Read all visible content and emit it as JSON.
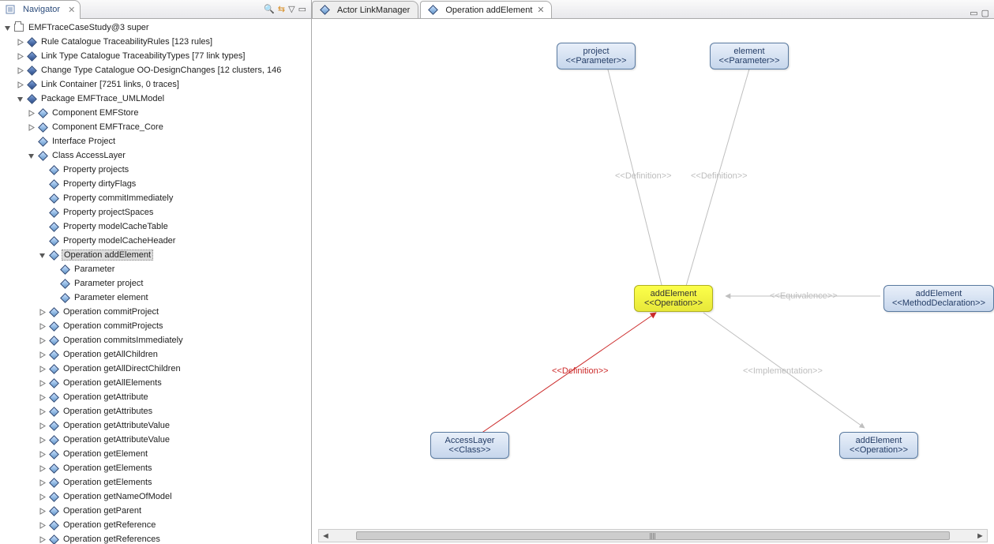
{
  "navigator": {
    "title": "Navigator",
    "root": "EMFTraceCaseStudy@3 super",
    "items": [
      {
        "ind": 1,
        "tw": "closed",
        "icon": "diamond",
        "label": "Rule Catalogue TraceabilityRules [123 rules]"
      },
      {
        "ind": 1,
        "tw": "closed",
        "icon": "diamond",
        "label": "Link Type Catalogue TraceabilityTypes [77 link types]"
      },
      {
        "ind": 1,
        "tw": "closed",
        "icon": "diamond",
        "label": "Change Type Catalogue OO-DesignChanges [12 clusters, 146"
      },
      {
        "ind": 1,
        "tw": "closed",
        "icon": "diamond",
        "label": "Link Container [7251 links, 0 traces]"
      },
      {
        "ind": 1,
        "tw": "open",
        "icon": "diamond",
        "label": "Package EMFTrace_UMLModel"
      },
      {
        "ind": 2,
        "tw": "closed",
        "icon": "diamond-pk",
        "label": "Component EMFStore"
      },
      {
        "ind": 2,
        "tw": "closed",
        "icon": "diamond-pk",
        "label": "Component EMFTrace_Core"
      },
      {
        "ind": 2,
        "tw": "blank",
        "icon": "diamond-pk",
        "label": "Interface Project"
      },
      {
        "ind": 2,
        "tw": "open",
        "icon": "diamond-pk",
        "label": "Class AccessLayer"
      },
      {
        "ind": 3,
        "tw": "blank",
        "icon": "diamond-pk",
        "label": "Property projects"
      },
      {
        "ind": 3,
        "tw": "blank",
        "icon": "diamond-pk",
        "label": "Property dirtyFlags"
      },
      {
        "ind": 3,
        "tw": "blank",
        "icon": "diamond-pk",
        "label": "Property commitImmediately"
      },
      {
        "ind": 3,
        "tw": "blank",
        "icon": "diamond-pk",
        "label": "Property projectSpaces"
      },
      {
        "ind": 3,
        "tw": "blank",
        "icon": "diamond-pk",
        "label": "Property modelCacheTable"
      },
      {
        "ind": 3,
        "tw": "blank",
        "icon": "diamond-pk",
        "label": "Property modelCacheHeader"
      },
      {
        "ind": 3,
        "tw": "open",
        "icon": "diamond-pk",
        "label": "Operation addElement",
        "sel": true
      },
      {
        "ind": 4,
        "tw": "blank",
        "icon": "diamond-pk",
        "label": "Parameter"
      },
      {
        "ind": 4,
        "tw": "blank",
        "icon": "diamond-pk",
        "label": "Parameter project"
      },
      {
        "ind": 4,
        "tw": "blank",
        "icon": "diamond-pk",
        "label": "Parameter element"
      },
      {
        "ind": 3,
        "tw": "closed",
        "icon": "diamond-pk",
        "label": "Operation commitProject"
      },
      {
        "ind": 3,
        "tw": "closed",
        "icon": "diamond-pk",
        "label": "Operation commitProjects"
      },
      {
        "ind": 3,
        "tw": "closed",
        "icon": "diamond-pk",
        "label": "Operation commitsImmediately"
      },
      {
        "ind": 3,
        "tw": "closed",
        "icon": "diamond-pk",
        "label": "Operation getAllChildren"
      },
      {
        "ind": 3,
        "tw": "closed",
        "icon": "diamond-pk",
        "label": "Operation getAllDirectChildren"
      },
      {
        "ind": 3,
        "tw": "closed",
        "icon": "diamond-pk",
        "label": "Operation getAllElements"
      },
      {
        "ind": 3,
        "tw": "closed",
        "icon": "diamond-pk",
        "label": "Operation getAttribute"
      },
      {
        "ind": 3,
        "tw": "closed",
        "icon": "diamond-pk",
        "label": "Operation getAttributes"
      },
      {
        "ind": 3,
        "tw": "closed",
        "icon": "diamond-pk",
        "label": "Operation getAttributeValue"
      },
      {
        "ind": 3,
        "tw": "closed",
        "icon": "diamond-pk",
        "label": "Operation getAttributeValue"
      },
      {
        "ind": 3,
        "tw": "closed",
        "icon": "diamond-pk",
        "label": "Operation getElement"
      },
      {
        "ind": 3,
        "tw": "closed",
        "icon": "diamond-pk",
        "label": "Operation getElements"
      },
      {
        "ind": 3,
        "tw": "closed",
        "icon": "diamond-pk",
        "label": "Operation getElements"
      },
      {
        "ind": 3,
        "tw": "closed",
        "icon": "diamond-pk",
        "label": "Operation getNameOfModel"
      },
      {
        "ind": 3,
        "tw": "closed",
        "icon": "diamond-pk",
        "label": "Operation getParent"
      },
      {
        "ind": 3,
        "tw": "closed",
        "icon": "diamond-pk",
        "label": "Operation getReference"
      },
      {
        "ind": 3,
        "tw": "closed",
        "icon": "diamond-pk",
        "label": "Operation getReferences"
      }
    ]
  },
  "editor": {
    "tabs": [
      {
        "label": "Actor LinkManager",
        "active": false
      },
      {
        "label": "Operation addElement",
        "active": true
      }
    ],
    "nodes": {
      "project": {
        "title": "project",
        "stereo": "<<Parameter>>"
      },
      "element": {
        "title": "element",
        "stereo": "<<Parameter>>"
      },
      "addElementOp": {
        "title": "addElement",
        "stereo": "<<Operation>>"
      },
      "addElementMD": {
        "title": "addElement",
        "stereo": "<<MethodDeclaration>>"
      },
      "accessLayer": {
        "title": "AccessLayer",
        "stereo": "<<Class>>"
      },
      "addElementOp2": {
        "title": "addElement",
        "stereo": "<<Operation>>"
      }
    },
    "edgeLabels": {
      "def1": "<<Definition>>",
      "def2": "<<Definition>>",
      "equiv": "<<Equivalence>>",
      "defRed": "<<Definition>>",
      "impl": "<<Implementation>>"
    }
  }
}
